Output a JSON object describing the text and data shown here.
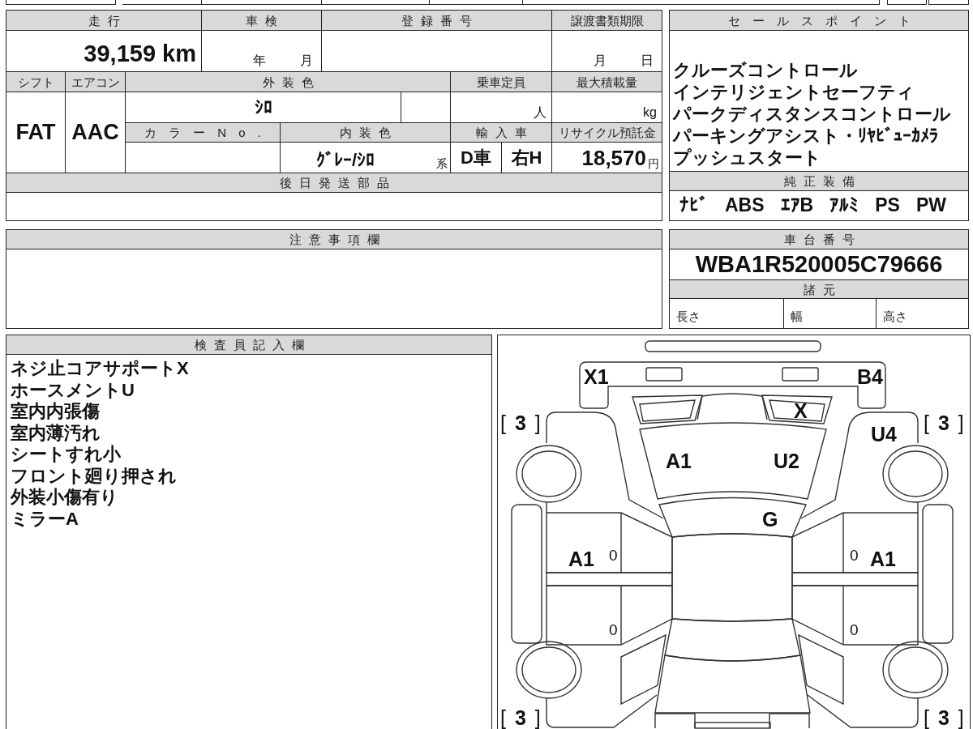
{
  "vehicle_table": {
    "mileage": {
      "label": "走行",
      "value": "39,159 km"
    },
    "inspection": {
      "label": "車検",
      "year_unit": "年",
      "month_unit": "月"
    },
    "registration_number": {
      "label": "登録番号"
    },
    "transfer_deadline": {
      "label": "譲渡書類期限",
      "month_unit": "月",
      "day_unit": "日"
    },
    "shift": {
      "label": "シフト",
      "value": "FAT"
    },
    "air_conditioner": {
      "label": "エアコン",
      "value": "AAC"
    },
    "exterior_color": {
      "label": "外装色",
      "value": "ｼﾛ"
    },
    "capacity": {
      "label": "乗車定員",
      "unit": "人"
    },
    "max_load": {
      "label": "最大積載量",
      "unit": "kg"
    },
    "color_number": {
      "label": "カラーNo."
    },
    "interior_color": {
      "label": "内装色",
      "value": "ｸﾞﾚｰ/ｼﾛ",
      "suffix": "系"
    },
    "imported": {
      "label": "輸入車",
      "type": "D車",
      "steering": "右H"
    },
    "recycling_deposit": {
      "label": "リサイクル預託金",
      "value": "18,570",
      "unit": "円"
    },
    "parts_shipped_later": {
      "label": "後日発送部品"
    }
  },
  "sales_points": {
    "label": "セールスポイント",
    "items": [
      "クルーズコントロール",
      "インテリジェントセーフティ",
      "パークディスタンスコントロール",
      "パーキングアシスト・ﾘﾔﾋﾞｭｰｶﾒﾗ",
      "プッシュスタート"
    ]
  },
  "standard_equipment": {
    "label": "純正装備",
    "items": [
      "ﾅﾋﾞ",
      "ABS",
      "ｴｱB",
      "ｱﾙﾐ",
      "PS",
      "PW"
    ]
  },
  "notes": {
    "label": "注意事項欄"
  },
  "chassis_number": {
    "label": "車台番号",
    "value": "WBA1R520005C79666"
  },
  "specifications": {
    "label": "諸元",
    "items": [
      "長さ",
      "幅",
      "高さ"
    ]
  },
  "inspector_notes": {
    "label": "検査員記入欄",
    "lines": [
      "ネジ止コアサポートX",
      "ホースメントU",
      "室内内張傷",
      "室内薄汚れ",
      "シートすれ小",
      "フロント廻り押され",
      "外装小傷有り",
      "ミラーA"
    ]
  },
  "damage_diagram": {
    "codes": [
      "X1",
      "B4",
      "X",
      "U4",
      "A1",
      "U2",
      "G",
      "A1",
      "A1"
    ],
    "tire_treads": [
      "[ **3** ]",
      "[ **3** ]",
      "[ **3** ]",
      "[ **3** ]"
    ],
    "door_marks": [
      "0",
      "0",
      "0",
      "0"
    ]
  }
}
